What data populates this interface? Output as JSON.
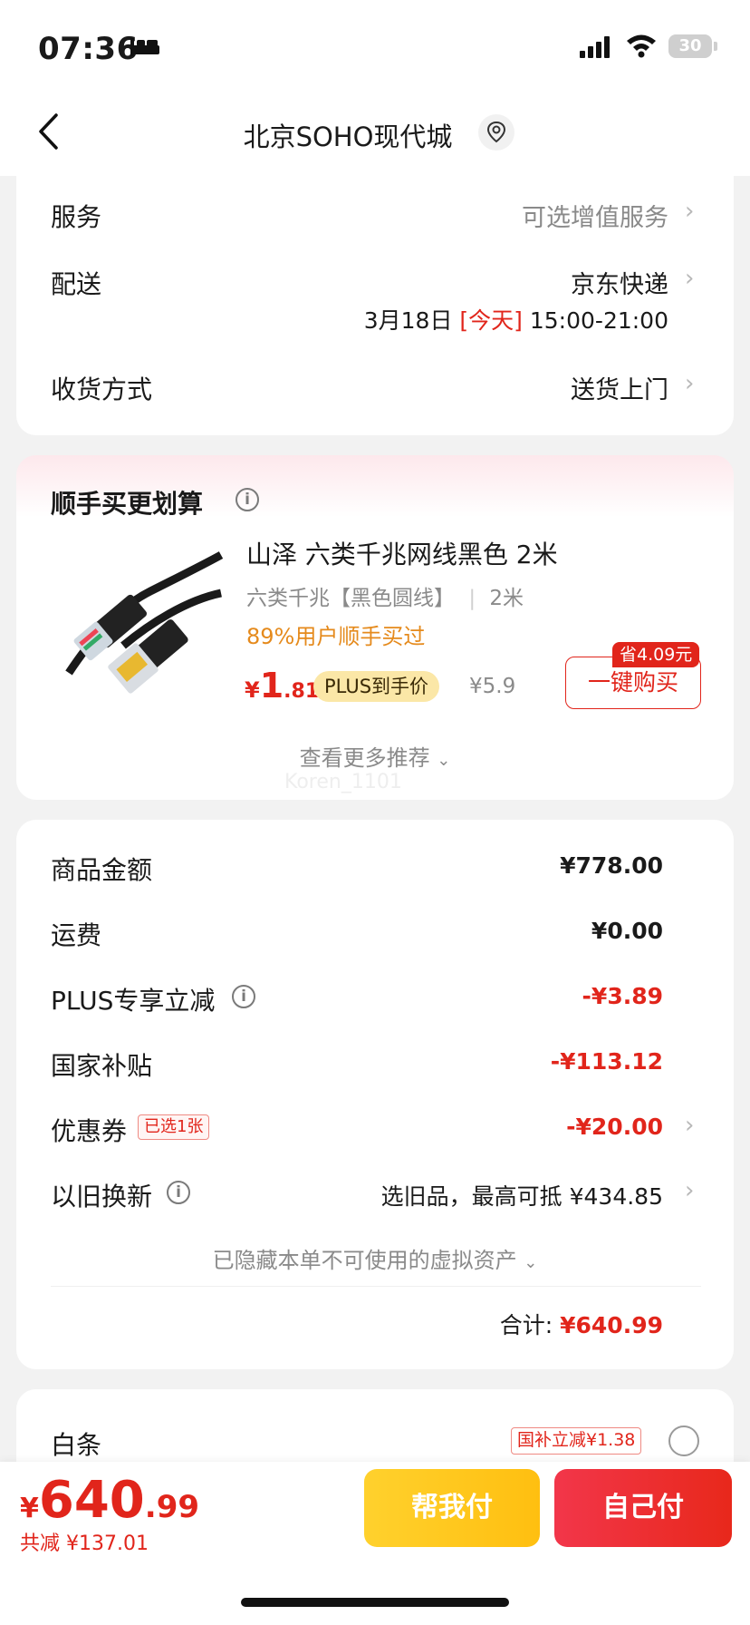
{
  "status_bar": {
    "time": "07:36",
    "battery": "30"
  },
  "nav": {
    "title": "北京SOHO现代城"
  },
  "service_card": {
    "service_label": "服务",
    "service_value": "可选增值服务",
    "delivery_label": "配送",
    "delivery_value": "京东快递",
    "delivery_date": "3月18日",
    "delivery_today": "[今天]",
    "delivery_time": "15:00-21:00",
    "receive_label": "收货方式",
    "receive_value": "送货上门"
  },
  "recommend": {
    "title": "顺手买更划算",
    "product_name": "山泽 六类千兆网线黑色 2米",
    "spec_main": "六类千兆【黑色圆线】",
    "spec_len": "2米",
    "bought_text": "89%用户顺手买过",
    "price_symbol": "¥",
    "price_int": "1",
    "price_dec": ".81",
    "plus_badge": "PLUS到手价",
    "orig_price": "¥5.9",
    "save_tag": "省4.09元",
    "buy_button": "一键购买",
    "more_link": "查看更多推荐",
    "watermark": "Koren_1101"
  },
  "summary": {
    "goods_label": "商品金额",
    "goods_value": "¥778.00",
    "freight_label": "运费",
    "freight_value": "¥0.00",
    "plus_label": "PLUS专享立减",
    "plus_value": "-¥3.89",
    "subsidy_label": "国家补贴",
    "subsidy_value": "-¥113.12",
    "coupon_label": "优惠券",
    "coupon_tag": "已选1张",
    "coupon_value": "-¥20.00",
    "tradein_label": "以旧换新",
    "tradein_value": "选旧品，最高可抵 ¥434.85",
    "hidden_link": "已隐藏本单不可使用的虚拟资产",
    "total_label": "合计:",
    "total_value": "¥640.99"
  },
  "payment": {
    "baitiao_label": "白条",
    "baitiao_tag": "国补立减¥1.38"
  },
  "bottom": {
    "price_symbol": "¥",
    "price_int": "640",
    "price_dec": ".99",
    "saved": "共减 ¥137.01",
    "help_pay": "帮我付",
    "self_pay": "自己付"
  },
  "colors": {
    "accent_red": "#e1251b",
    "plus_gold": "#fbe7a7",
    "help_yellow": "#ffc91d"
  }
}
